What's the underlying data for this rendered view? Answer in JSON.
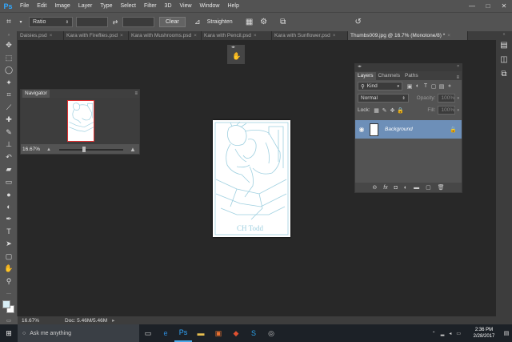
{
  "app": {
    "logo": "Ps"
  },
  "menu": [
    "File",
    "Edit",
    "Image",
    "Layer",
    "Type",
    "Select",
    "Filter",
    "3D",
    "View",
    "Window",
    "Help"
  ],
  "window_controls": [
    "—",
    "□",
    "✕"
  ],
  "options_bar": {
    "ratio_value": "Ratio",
    "clear_label": "Clear",
    "straighten_label": "Straighten"
  },
  "tabs": [
    {
      "label": "Daisies.psd"
    },
    {
      "label": "Kara with Fireflies.psd"
    },
    {
      "label": "Kara with Mushrooms.psd"
    },
    {
      "label": "Kara with Pencil.psd"
    },
    {
      "label": "Kara with Sunflower.psd"
    },
    {
      "label": "Thumbs009.jpg @ 16.7% (Monotone/8) *",
      "active": true
    }
  ],
  "navigator": {
    "title": "Navigator",
    "zoom": "16.67%",
    "zoom_fraction": 0.38
  },
  "layers": {
    "tabs": [
      "Layers",
      "Channels",
      "Paths"
    ],
    "filter_kind": "Kind",
    "blend_mode": "Normal",
    "opacity_label": "Opacity:",
    "opacity_value": "100%",
    "lock_label": "Lock:",
    "fill_label": "Fill:",
    "fill_value": "100%",
    "layer_name": "Background"
  },
  "statusbar": {
    "zoom": "16.67%",
    "doc": "Doc: 5.46M/5.46M"
  },
  "taskbar": {
    "search_placeholder": "Ask me anything",
    "time": "2:36 PM",
    "date": "2/28/2017"
  },
  "colors": {
    "foreground": "#d8eef6",
    "background": "#ffffff",
    "selected_layer": "#6d8fb8",
    "sketch_line": "#9fd0e0"
  }
}
